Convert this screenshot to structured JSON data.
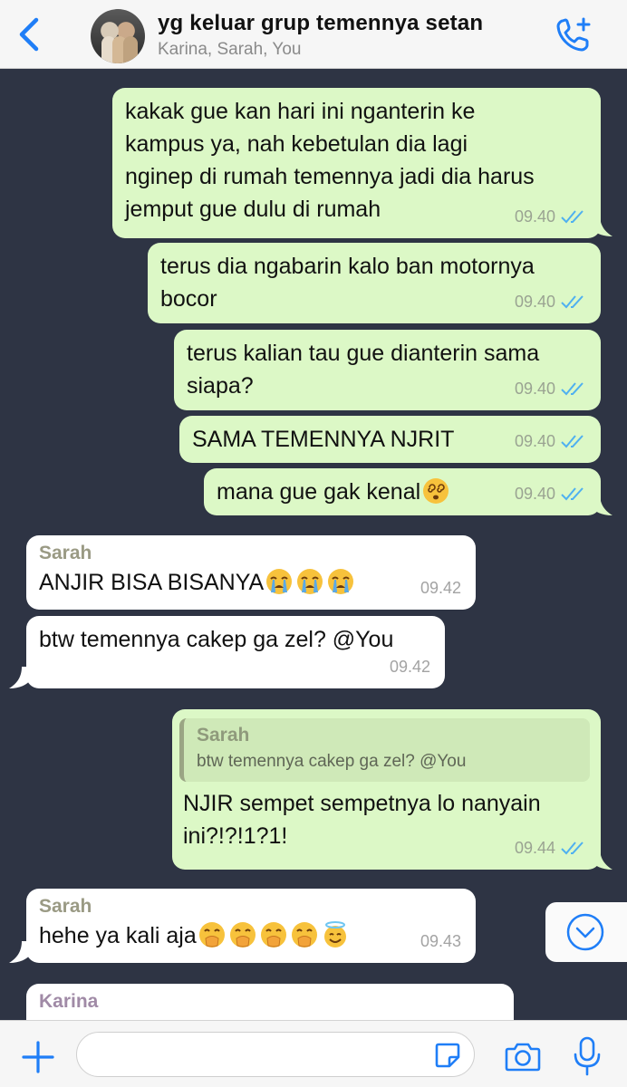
{
  "header": {
    "title": "yg keluar grup temennya setan",
    "subtitle": "Karina, Sarah, You"
  },
  "messages": [
    {
      "dir": "out",
      "text": "kakak gue kan hari ini nganterin ke\nkampus ya, nah kebetulan dia lagi\nnginep di rumah temennya jadi dia harus\njemput gue dulu di rumah",
      "time": "09.40"
    },
    {
      "dir": "out",
      "text": "terus dia ngabarin kalo ban motornya\nbocor",
      "time": "09.40"
    },
    {
      "dir": "out",
      "text": "terus kalian tau gue dianterin sama\nsiapa?",
      "time": "09.40"
    },
    {
      "dir": "out",
      "text": "SAMA TEMENNYA NJRIT",
      "time": "09.40"
    },
    {
      "dir": "out",
      "text": "mana gue gak kenal",
      "emoji": [
        "dizzy-face"
      ],
      "time": "09.40"
    },
    {
      "dir": "in",
      "sender": "Sarah",
      "text": "ANJIR BISA BISANYA",
      "emoji": [
        "crying-face",
        "crying-face",
        "crying-face"
      ],
      "time": "09.42"
    },
    {
      "dir": "in",
      "text": "btw temennya cakep ga zel? @You",
      "time": "09.42"
    },
    {
      "dir": "out",
      "quote": {
        "sender": "Sarah",
        "text": "btw temennya cakep ga zel? @You"
      },
      "text": "NJIR sempet sempetnya lo nanyain\nini?!?!1?1!",
      "time": "09.44"
    },
    {
      "dir": "in",
      "sender": "Sarah",
      "text": "hehe ya kali aja",
      "emoji": [
        "hand-over-mouth",
        "hand-over-mouth",
        "hand-over-mouth",
        "hand-over-mouth",
        "smiling-halo"
      ],
      "time": "09.43"
    },
    {
      "dir": "in",
      "sender": "Karina",
      "text": "",
      "time": ""
    }
  ],
  "composer": {
    "placeholder": ""
  },
  "colors": {
    "accent": "#1f7ef7",
    "outgoing": "#dcf8c6",
    "incoming": "#ffffff",
    "background": "#2e3444",
    "read_ticks": "#4fb0f0"
  },
  "icons": [
    "back-chevron-icon",
    "add-call-icon",
    "scroll-down-icon",
    "plus-icon",
    "sticker-icon",
    "camera-icon",
    "microphone-icon"
  ]
}
